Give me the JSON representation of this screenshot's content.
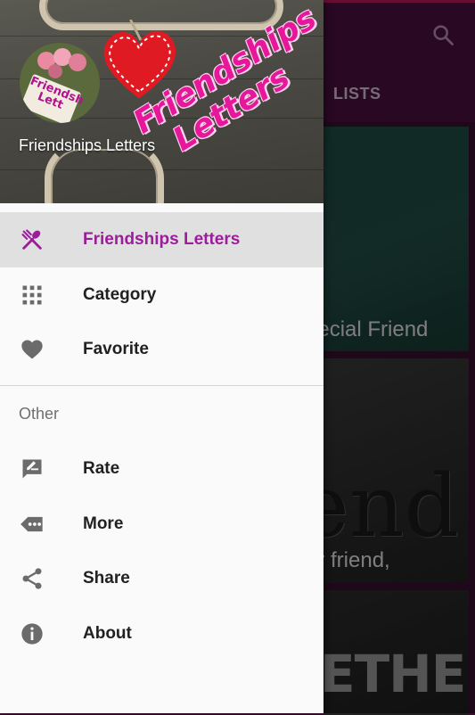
{
  "app": {
    "tab_label": "LISTS",
    "card_1_text": "pecial Friend",
    "card_2_big": "end",
    "card_2_text": "ar friend,",
    "card_3_big": "ETHER"
  },
  "drawer": {
    "header_title": "Friendships Letters",
    "header_logo_line1": "Friendships",
    "header_logo_line2": "Letters",
    "avatar_note_line1": "Friendsh",
    "avatar_note_line2": "Lett",
    "items": [
      {
        "label": "Friendships Letters",
        "icon": "spoon-fork-icon",
        "active": true
      },
      {
        "label": "Category",
        "icon": "grid-icon",
        "active": false
      },
      {
        "label": "Favorite",
        "icon": "heart-icon",
        "active": false
      }
    ],
    "section_title": "Other",
    "other_items": [
      {
        "label": "Rate",
        "icon": "rate-review-icon"
      },
      {
        "label": "More",
        "icon": "more-icon"
      },
      {
        "label": "Share",
        "icon": "share-icon"
      },
      {
        "label": "About",
        "icon": "info-icon"
      }
    ]
  },
  "colors": {
    "accent": "#9c1d9c",
    "toolbar": "#4a1040",
    "active_row": "#e0e0e0",
    "icon_grey": "#6b6b6b"
  }
}
